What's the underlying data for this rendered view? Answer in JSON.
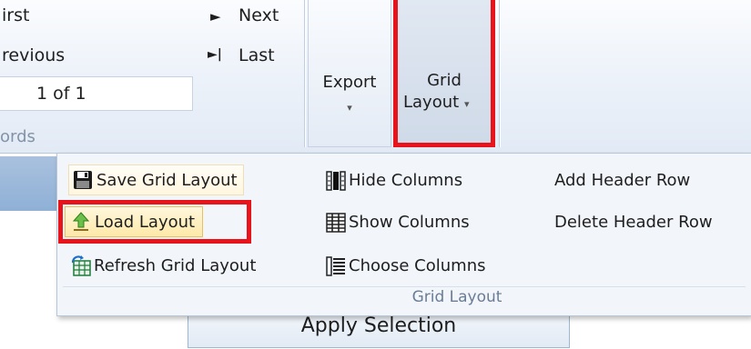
{
  "ribbon": {
    "nav": {
      "first": "irst",
      "previous": "revious",
      "next": "Next",
      "last": "Last",
      "page_value": "1 of 1",
      "group_caption": "ords"
    },
    "export_label": "Export",
    "grid_layout_label_line1": "Grid",
    "grid_layout_label_line2": "Layout",
    "dropdown_arrow": "▾",
    "next_glyph": "►",
    "last_glyph": "►|"
  },
  "dropdown": {
    "items": {
      "save_grid_layout": "Save Grid Layout",
      "load_layout": "Load Layout",
      "refresh_grid_layout": "Refresh Grid Layout",
      "hide_columns": "Hide Columns",
      "show_columns": "Show Columns",
      "choose_columns": "Choose Columns",
      "add_header_row": "Add Header Row",
      "delete_header_row": "Delete Header Row"
    },
    "group_caption": "Grid Layout"
  },
  "apply_selection": "Apply Selection",
  "icons": {
    "save": "save-icon",
    "load": "load-arrow-icon",
    "refresh": "refresh-grid-icon",
    "hide": "hide-columns-icon",
    "show": "show-columns-icon",
    "choose": "choose-columns-icon"
  },
  "colors": {
    "highlight_red": "#e8141c",
    "hover_gold": "#fde9a8",
    "ribbon_blue": "#e2eaf5"
  }
}
